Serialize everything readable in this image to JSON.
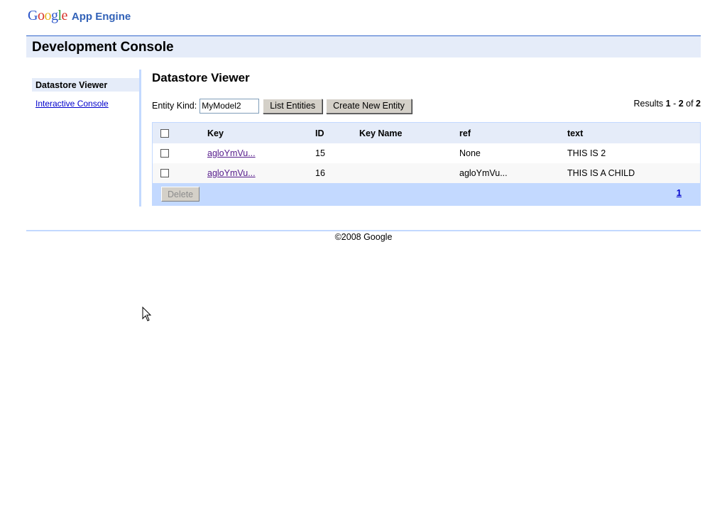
{
  "header": {
    "logo_letters": [
      "G",
      "o",
      "o",
      "g",
      "l",
      "e"
    ],
    "product": "App Engine"
  },
  "console": {
    "title": "Development Console"
  },
  "sidebar": {
    "items": [
      {
        "label": "Datastore Viewer",
        "selected": true
      },
      {
        "label": "Interactive Console",
        "selected": false
      }
    ]
  },
  "main": {
    "title": "Datastore Viewer",
    "entity_kind_label": "Entity Kind:",
    "entity_kind_value": "MyModel2",
    "list_button": "List Entities",
    "create_button": "Create New Entity",
    "results": {
      "prefix": "Results ",
      "start": "1",
      "sep": " - ",
      "end": "2",
      "of": " of ",
      "total": "2"
    },
    "table": {
      "columns": [
        "Key",
        "ID",
        "Key Name",
        "ref",
        "text"
      ],
      "rows": [
        {
          "key": "agloYmVu...",
          "id": "15",
          "key_name": "",
          "ref": "None",
          "text": "THIS IS 2"
        },
        {
          "key": "agloYmVu...",
          "id": "16",
          "key_name": "",
          "ref": "agloYmVu...",
          "text": "THIS IS A CHILD"
        }
      ]
    },
    "delete_button": "Delete",
    "page": "1"
  },
  "footer": {
    "copyright": "©2008 Google"
  },
  "colors": {
    "header_bg": "#e5ecf9",
    "accent": "#c3d9ff",
    "link": "#0000cc",
    "visited": "#551a8b"
  }
}
